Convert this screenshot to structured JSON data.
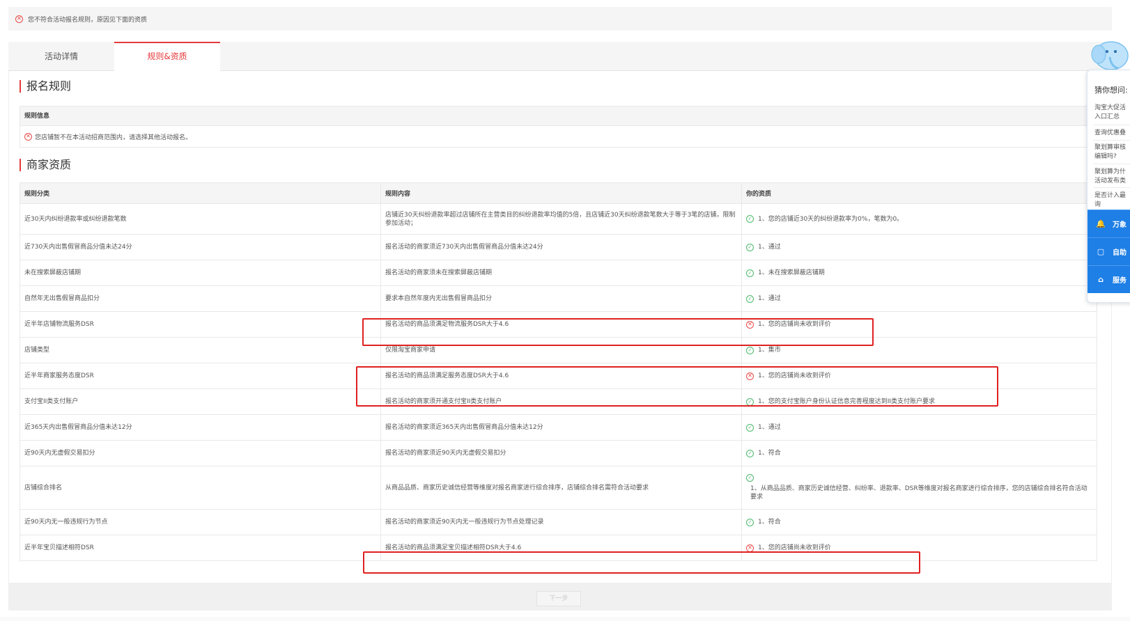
{
  "alert": {
    "text": "您不符合活动报名规则，原因见下面的资质"
  },
  "tabs": [
    {
      "label": "活动详情"
    },
    {
      "label": "规则&资质"
    }
  ],
  "rules_section": {
    "title": "报名规则",
    "box_header": "规则信息",
    "message": "您店铺暂不在本活动招商范围内，请选择其他活动报名。"
  },
  "qual_section": {
    "title": "商家资质",
    "columns": [
      "规则分类",
      "规则内容",
      "你的资质"
    ],
    "rows": [
      {
        "category": "近30天内纠纷退款率或纠纷退款笔数",
        "content": "店铺近30天纠纷退款率超过店铺所在主营类目的纠纷退款率均值的5倍，且店铺近30天纠纷退款笔数大于等于3笔的店铺，限制参加活动；",
        "status": "pass",
        "result": "1、您的店铺近30天的纠纷退款率为0%，笔数为0。"
      },
      {
        "category": "近730天内出售假冒商品分值未达24分",
        "content": "报名活动的商家须近730天内出售假冒商品分值未达24分",
        "status": "pass",
        "result": "1、通过"
      },
      {
        "category": "未在搜索屏蔽店铺期",
        "content": "报名活动的商家须未在搜索屏蔽店铺期",
        "status": "pass",
        "result": "1、未在搜索屏蔽店铺期"
      },
      {
        "category": "自然年无出售假冒商品扣分",
        "content": "要求本自然年度内无出售假冒商品扣分",
        "status": "pass",
        "result": "1、通过"
      },
      {
        "category": "近半年店铺物流服务DSR",
        "content": "报名活动的商品须满足物流服务DSR大于4.6",
        "status": "fail",
        "result": "1、您的店铺尚未收到评价"
      },
      {
        "category": "店铺类型",
        "content": "仅限淘宝商家申请",
        "status": "pass",
        "result": "1、集市"
      },
      {
        "category": "近半年商家服务态度DSR",
        "content": "报名活动的商品须满足服务态度DSR大于4.6",
        "status": "fail",
        "result": "1、您的店铺尚未收到评价"
      },
      {
        "category": "支付宝II类支付账户",
        "content": "报名活动的商家须开通支付宝II类支付账户",
        "status": "pass",
        "result": "1、您的支付宝账户身份认证信息完善程度达到II类支付账户要求"
      },
      {
        "category": "近365天内出售假冒商品分值未达12分",
        "content": "报名活动的商家须近365天内出售假冒商品分值未达12分",
        "status": "pass",
        "result": "1、通过"
      },
      {
        "category": "近90天内无虚假交易扣分",
        "content": "报名活动的商家须近90天内无虚假交易扣分",
        "status": "pass",
        "result": "1、符合"
      },
      {
        "category": "店铺综合排名",
        "content": "从商品品质、商家历史诚信经营等维度对报名商家进行综合排序，店铺综合排名需符合活动要求",
        "status": "pass",
        "result": "1、从商品品质、商家历史诚信经营、纠纷率、退款率、DSR等维度对报名商家进行综合排序，您的店铺综合排名符合活动要求"
      },
      {
        "category": "近90天内无一般违规行为节点",
        "content": "报名活动的商家须近90天内无一般违规行为节点处理记录",
        "status": "pass",
        "result": "1、符合"
      },
      {
        "category": "近半年宝贝描述相符DSR",
        "content": "报名活动的商品须满足宝贝描述相符DSR大于4.6",
        "status": "fail",
        "result": "1、您的店铺尚未收到评价"
      }
    ]
  },
  "footer": {
    "next_label": "下一步"
  },
  "help_panel": {
    "title": "猜你想问:",
    "items": [
      "淘宝大促活\n入口汇总",
      "查询优惠叠",
      "聚划算审核\n编辑吗?",
      "聚划算为什\n活动发布类",
      "是否计入最\n询"
    ],
    "buttons": [
      {
        "label": "万象",
        "icon": "bell-icon"
      },
      {
        "label": "自助",
        "icon": "chat-icon"
      },
      {
        "label": "服务",
        "icon": "home-icon"
      }
    ]
  },
  "colors": {
    "accent": "#e4393c",
    "pass": "#4cba6a",
    "fail": "#e94a4a",
    "help_blue": "#1e7fe6",
    "annotation": "#e02020"
  }
}
